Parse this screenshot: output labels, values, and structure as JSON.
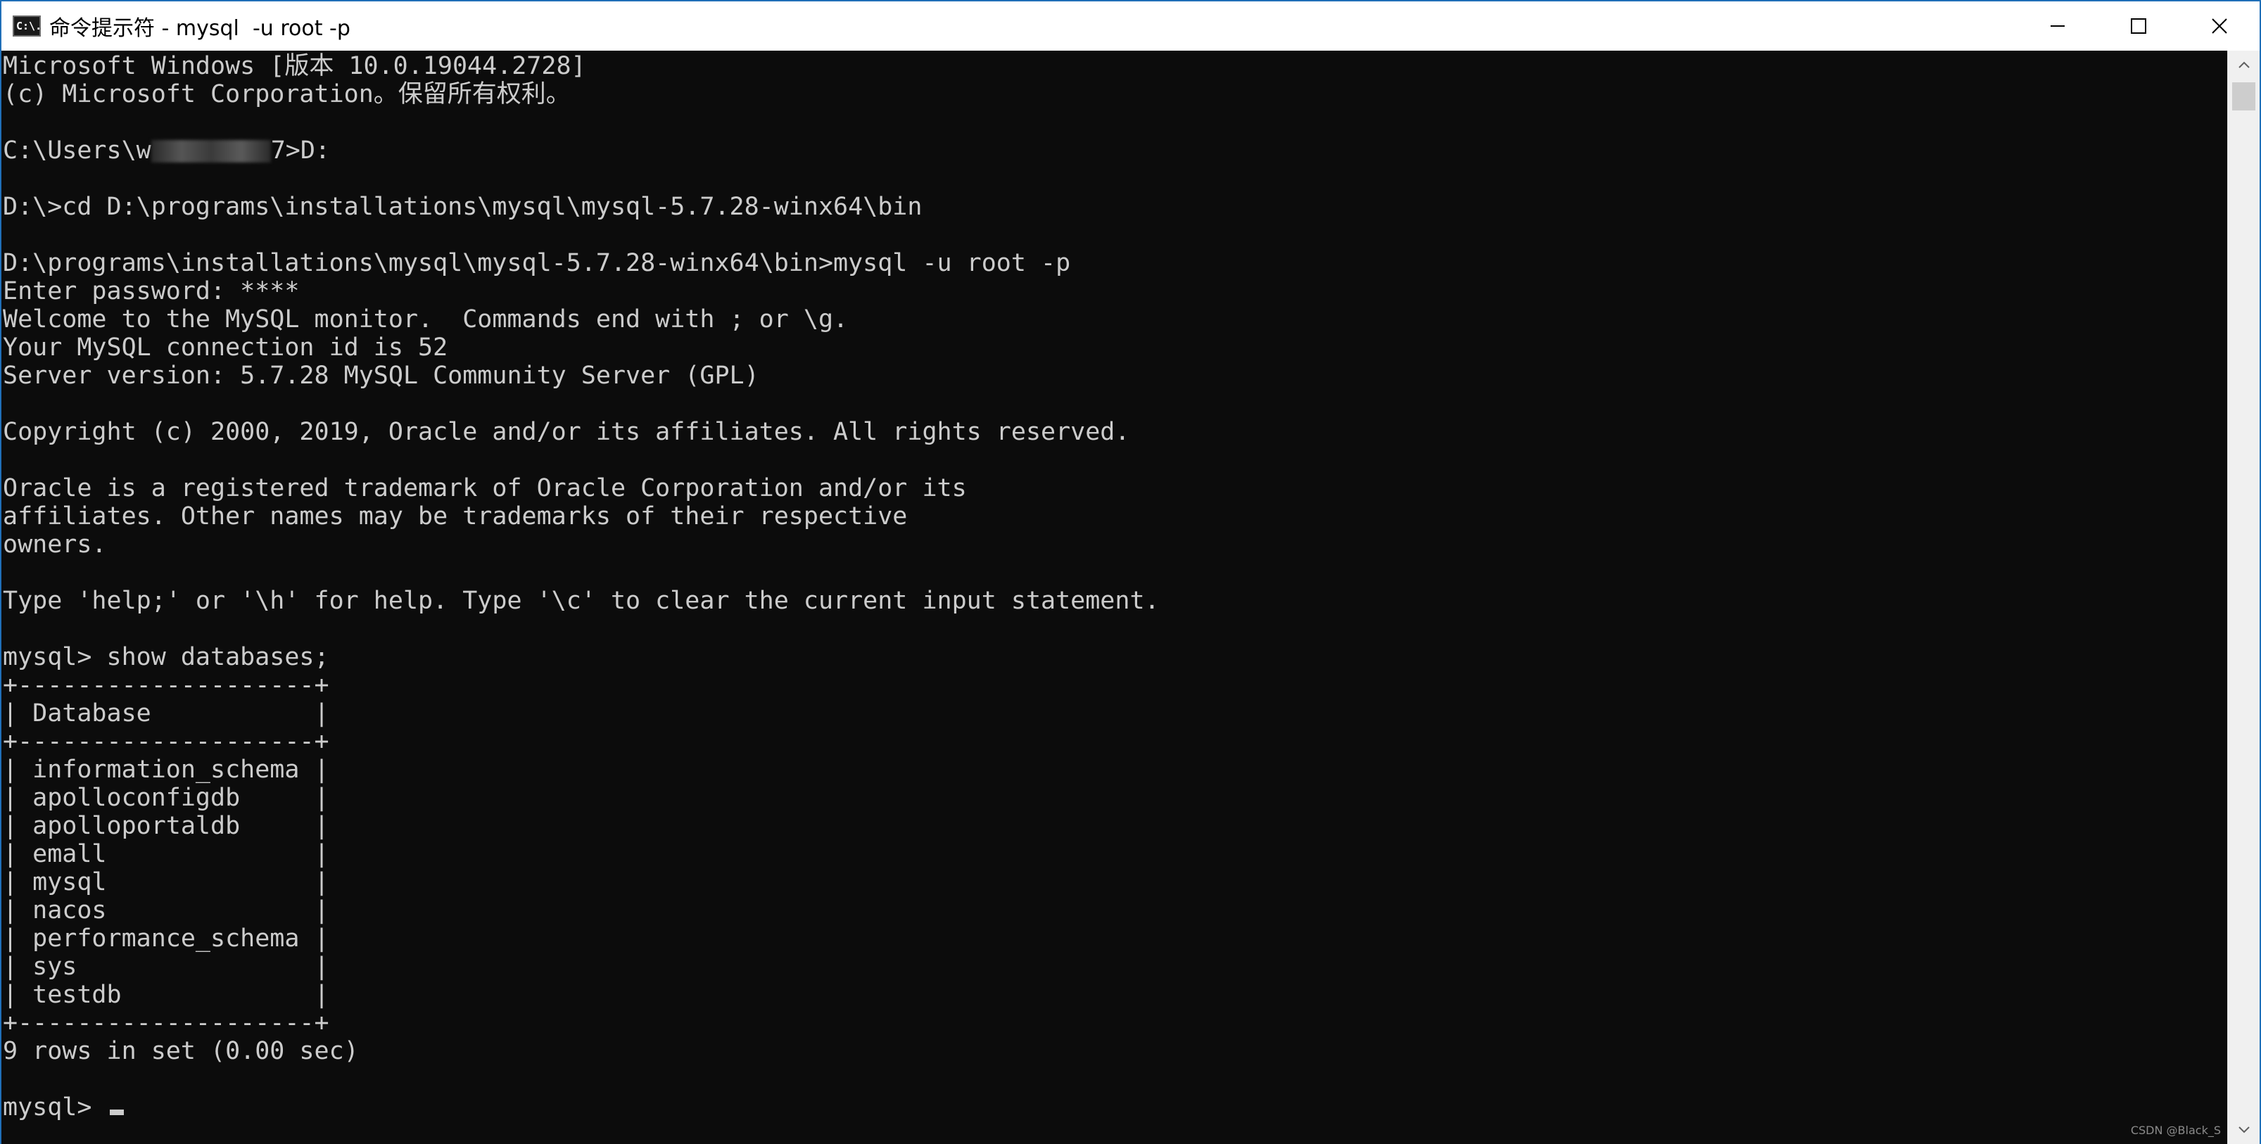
{
  "window": {
    "title": "命令提示符 - mysql  -u root -p",
    "icon_text": "C:\\.",
    "controls": [
      "minimize-icon",
      "maximize-icon",
      "close-icon"
    ]
  },
  "console": {
    "lines": [
      "Microsoft Windows [版本 10.0.19044.2728]",
      "(c) Microsoft Corporation。保留所有权利。",
      "",
      "C:\\Users\\w",
      "",
      "D:\\>cd D:\\programs\\installations\\mysql\\mysql-5.7.28-winx64\\bin",
      "",
      "D:\\programs\\installations\\mysql\\mysql-5.7.28-winx64\\bin>mysql -u root -p",
      "Enter password: ****",
      "Welcome to the MySQL monitor.  Commands end with ; or \\g.",
      "Your MySQL connection id is 52",
      "Server version: 5.7.28 MySQL Community Server (GPL)",
      "",
      "Copyright (c) 2000, 2019, Oracle and/or its affiliates. All rights reserved.",
      "",
      "Oracle is a registered trademark of Oracle Corporation and/or its",
      "affiliates. Other names may be trademarks of their respective",
      "owners.",
      "",
      "Type 'help;' or '\\h' for help. Type '\\c' to clear the current input statement.",
      "",
      "mysql> show databases;",
      "+--------------------+",
      "| Database           |",
      "+--------------------+",
      "| information_schema |",
      "| apolloconfigdb     |",
      "| apolloportaldb     |",
      "| emall              |",
      "| mysql              |",
      "| nacos              |",
      "| performance_schema |",
      "| sys                |",
      "| testdb             |",
      "+--------------------+",
      "9 rows in set (0.00 sec)",
      "",
      "mysql> "
    ],
    "redacted_line_suffix": "7>D:"
  },
  "watermark": "CSDN @Black_S"
}
